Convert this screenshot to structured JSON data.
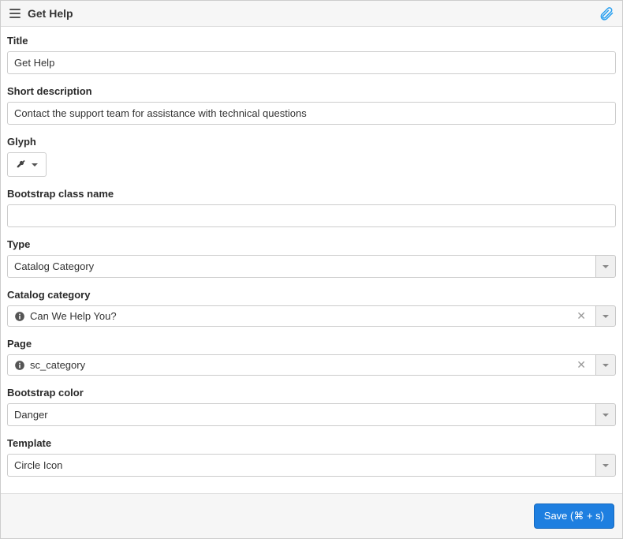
{
  "header": {
    "title": "Get Help"
  },
  "fields": {
    "title": {
      "label": "Title",
      "value": "Get Help"
    },
    "short_description": {
      "label": "Short description",
      "value": "Contact the support team for assistance with technical questions"
    },
    "glyph": {
      "label": "Glyph",
      "icon": "wrench"
    },
    "bootstrap_class": {
      "label": "Bootstrap class name",
      "value": ""
    },
    "type": {
      "label": "Type",
      "value": "Catalog Category"
    },
    "catalog_category": {
      "label": "Catalog category",
      "value": "Can We Help You?"
    },
    "page": {
      "label": "Page",
      "value": "sc_category"
    },
    "bootstrap_color": {
      "label": "Bootstrap color",
      "value": "Danger"
    },
    "template": {
      "label": "Template",
      "value": "Circle Icon"
    }
  },
  "footer": {
    "save_label": "Save  (⌘ + s)"
  }
}
